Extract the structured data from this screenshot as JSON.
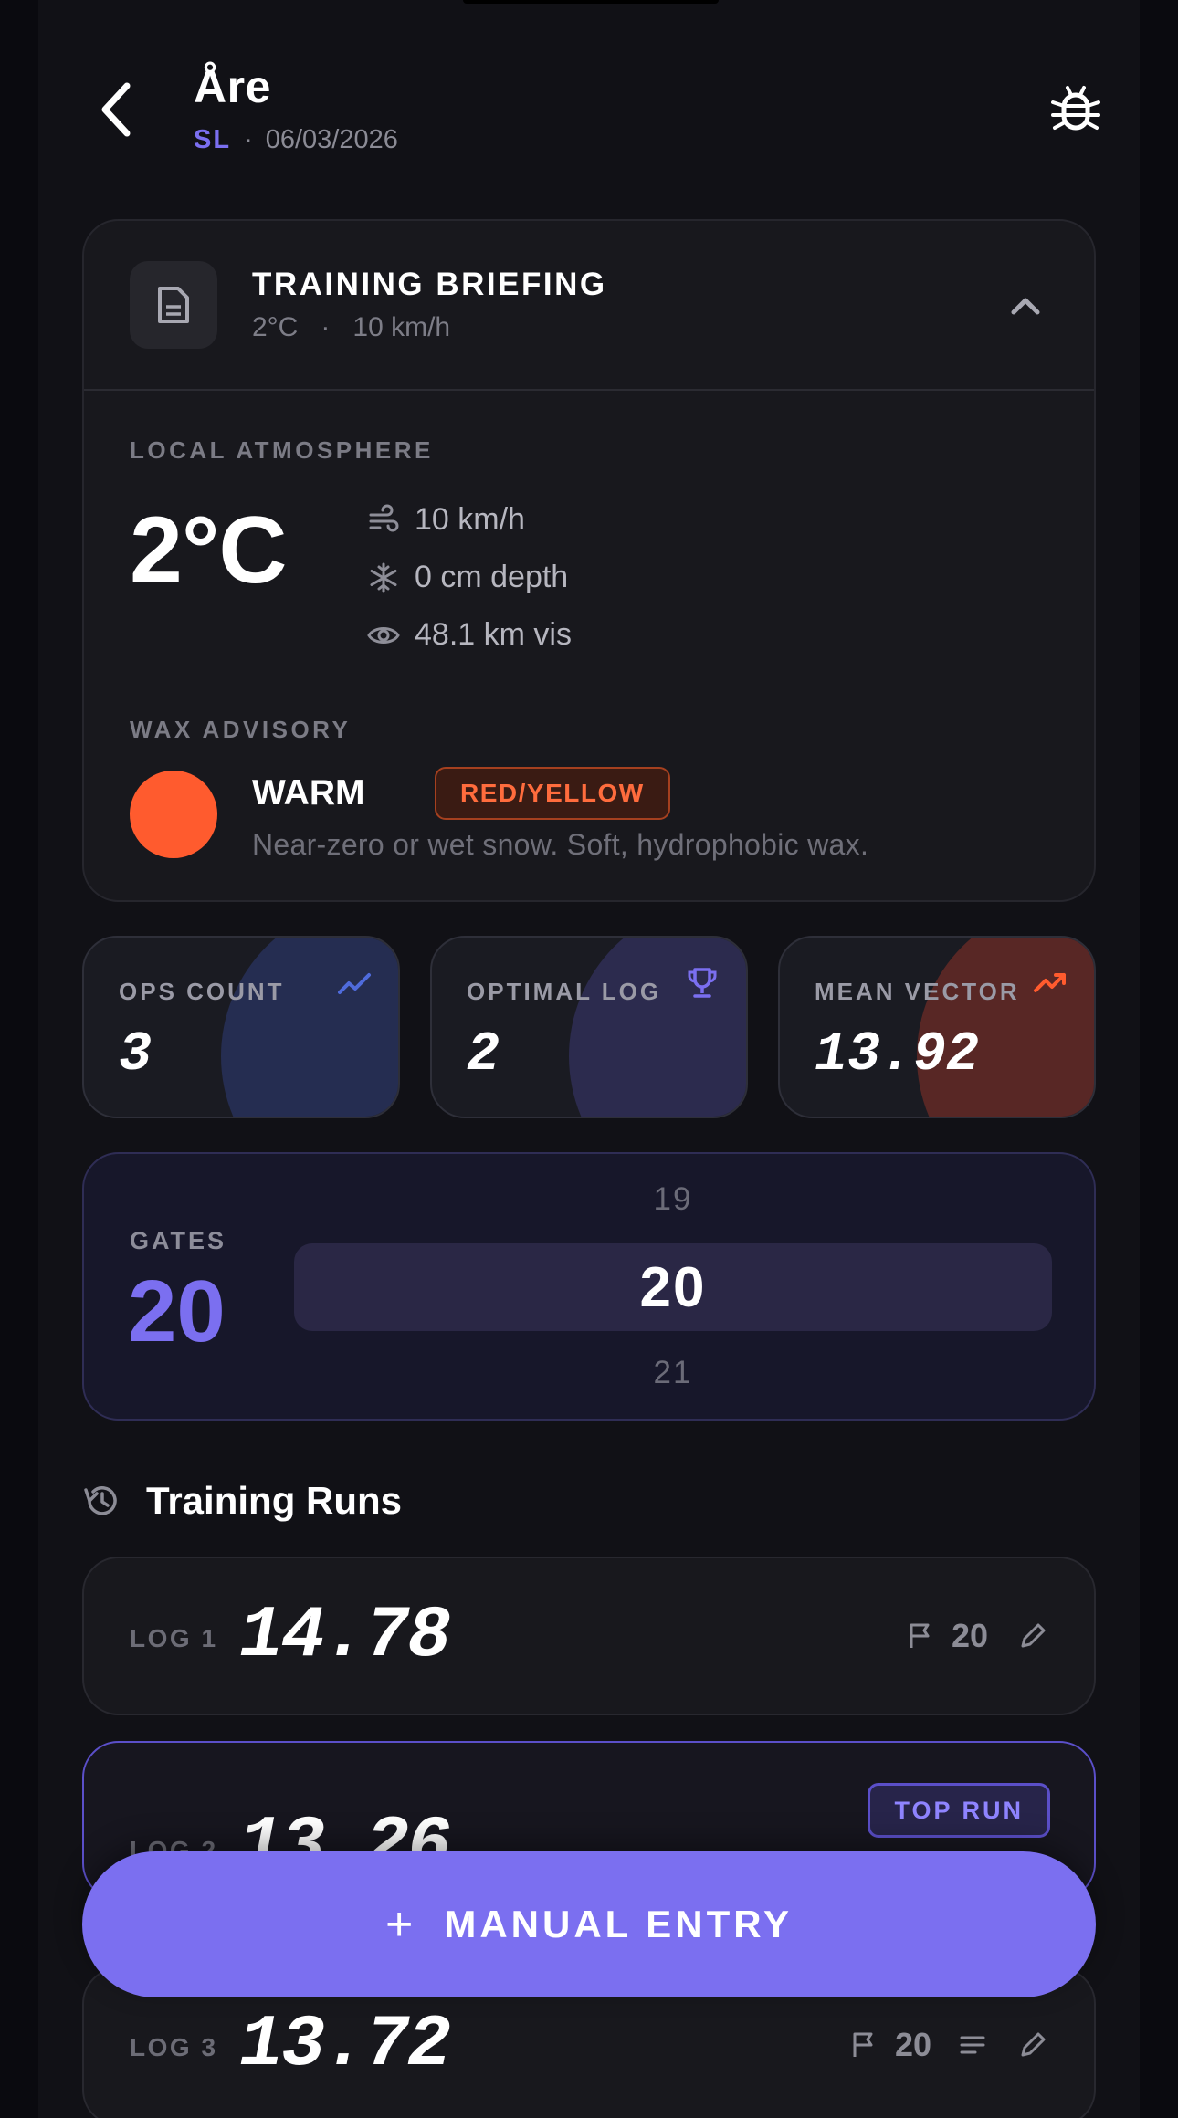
{
  "header": {
    "title": "Åre",
    "discipline": "SL",
    "separator": "·",
    "date": "06/03/2026"
  },
  "briefing": {
    "title": "TRAINING BRIEFING",
    "summary_temp": "2°C",
    "summary_sep": "·",
    "summary_wind": "10 km/h",
    "atmosphere_label": "LOCAL ATMOSPHERE",
    "temperature": "2°C",
    "wind": "10 km/h",
    "snow_depth": "0 cm depth",
    "visibility": "48.1 km vis",
    "wax_label": "WAX ADVISORY",
    "wax_name": "WARM",
    "wax_badge": "RED/YELLOW",
    "wax_description": "Near-zero or wet snow. Soft, hydrophobic wax.",
    "wax_color": "#ff5b2e"
  },
  "stats": [
    {
      "label": "OPS COUNT",
      "value": "3",
      "icon": "trend-line-icon",
      "accent": "#4f6bdc"
    },
    {
      "label": "OPTIMAL LOG",
      "value": "2",
      "icon": "trophy-icon",
      "accent": "#7b6ff0"
    },
    {
      "label": "MEAN VECTOR",
      "value": "13.92",
      "icon": "trending-up-icon",
      "accent": "#ff5b2e"
    }
  ],
  "gates": {
    "label": "GATES",
    "value": "20",
    "prev": "19",
    "selected": "20",
    "next": "21"
  },
  "runs": {
    "title": "Training Runs",
    "items": [
      {
        "label": "LOG 1",
        "time": "14.78",
        "gates": "20"
      },
      {
        "label": "LOG 2",
        "time": "13.26",
        "badge": "TOP RUN"
      },
      {
        "label": "LOG 3",
        "time": "13.72",
        "gates": "20"
      }
    ]
  },
  "actions": {
    "manual_entry": "MANUAL ENTRY",
    "plus": "+"
  },
  "colors": {
    "accent": "#7b6ff0",
    "background": "#111116",
    "card": "#18181d",
    "warm": "#ff5b2e"
  }
}
